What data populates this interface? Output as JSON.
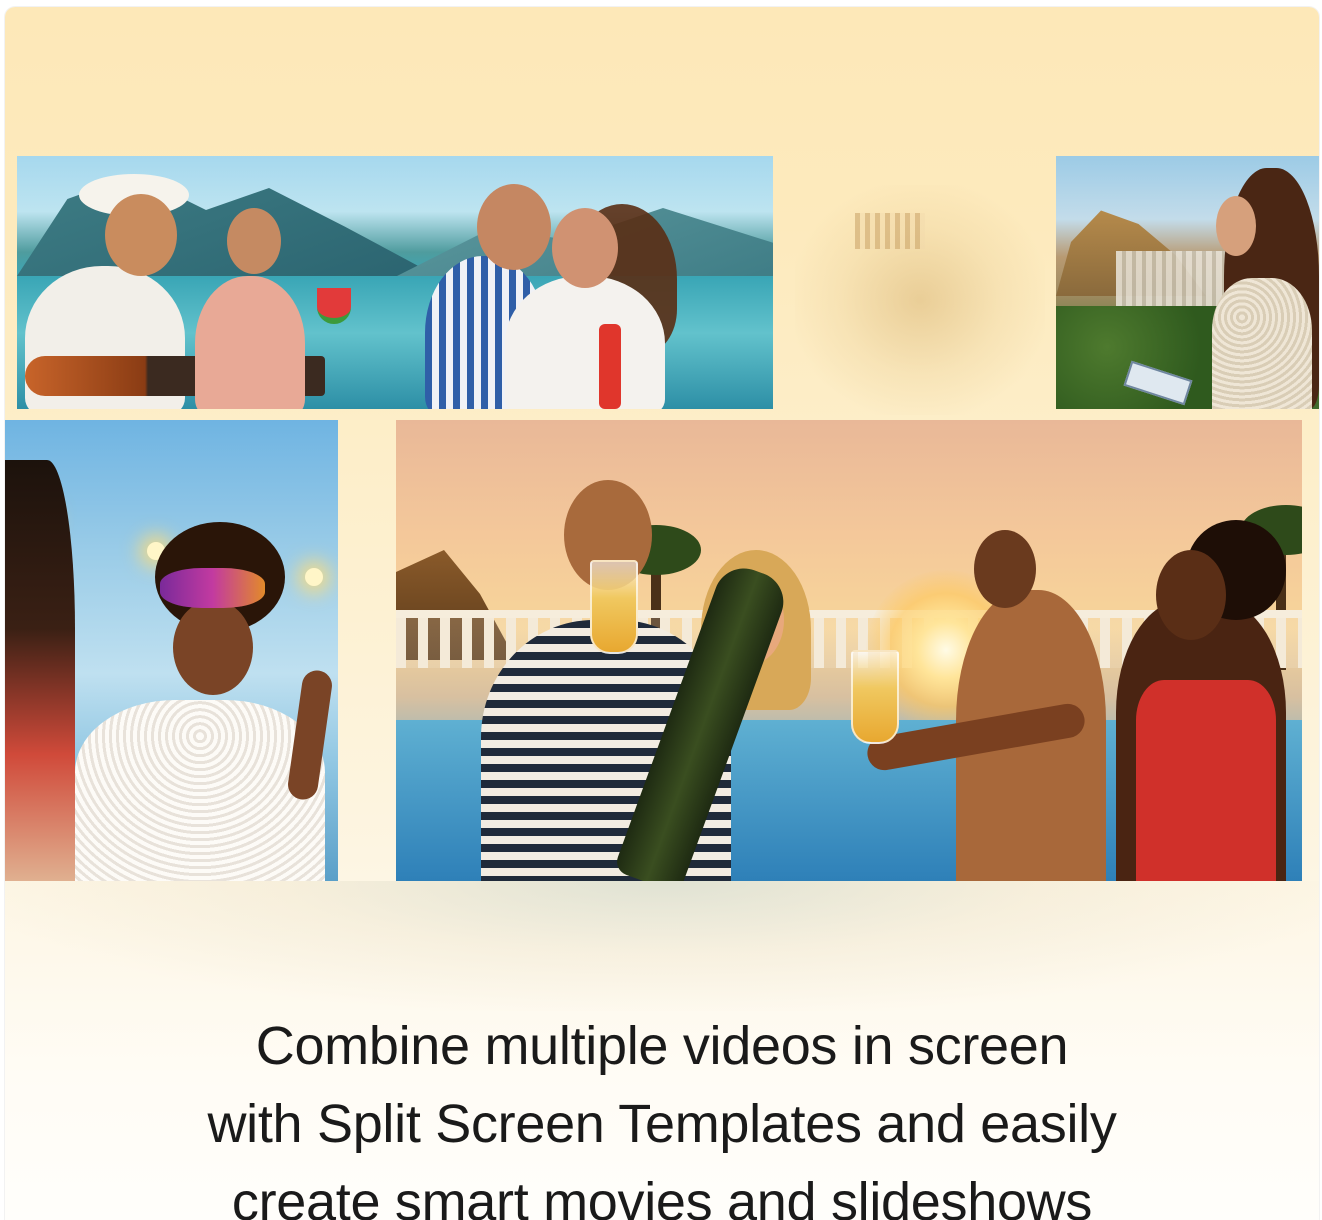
{
  "caption": {
    "line1": "Combine multiple videos in screen",
    "line2": "with Split Screen Templates and easily",
    "line3": "create smart movies and slideshows"
  },
  "colors": {
    "background_top": "#fde8b8",
    "background_bottom": "#fffefb",
    "caption_text": "#1a1a1a"
  }
}
